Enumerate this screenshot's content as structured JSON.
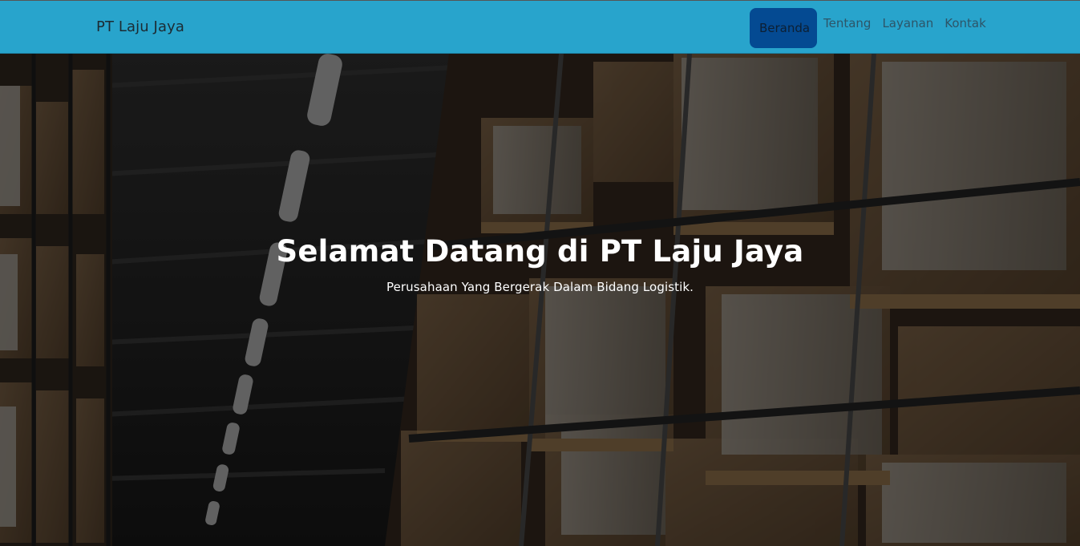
{
  "navbar": {
    "brand": "PT Laju Jaya",
    "links": [
      {
        "label": "Beranda",
        "active": true
      },
      {
        "label": "Tentang",
        "active": false
      },
      {
        "label": "Layanan",
        "active": false
      },
      {
        "label": "Kontak",
        "active": false
      }
    ],
    "bg_color": "#28a4cc",
    "active_color": "#044a92"
  },
  "hero": {
    "title": "Selamat Datang di PT Laju Jaya",
    "subtitle": "Perusahaan Yang Bergerak Dalam Bidang Logistik."
  }
}
